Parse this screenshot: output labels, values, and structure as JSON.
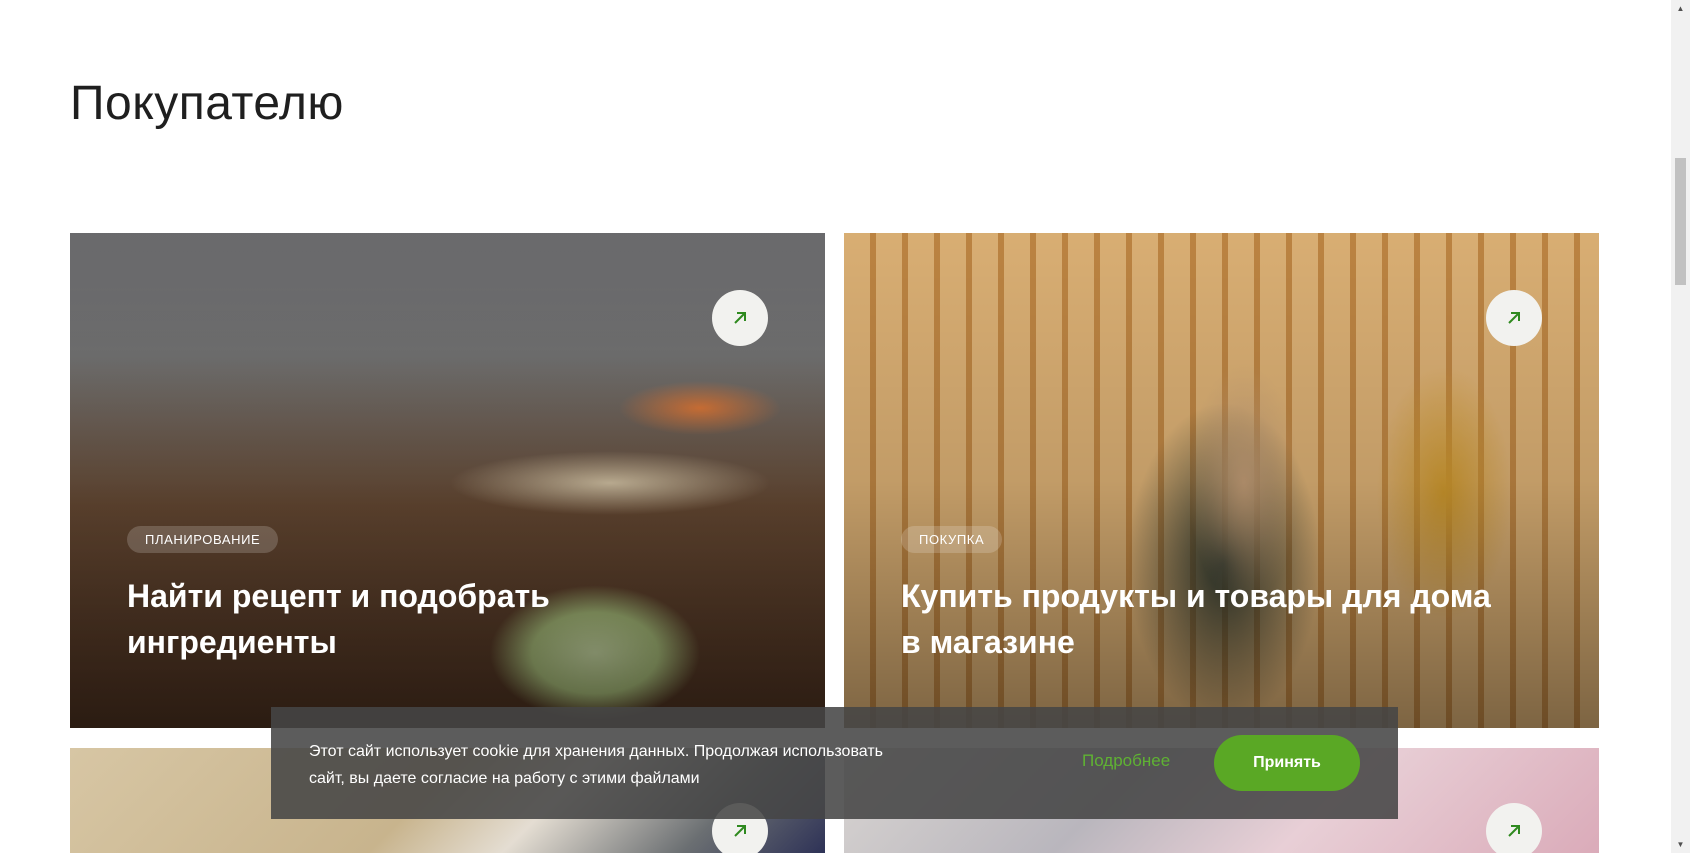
{
  "section": {
    "title": "Покупателю"
  },
  "cards": [
    {
      "tag": "ПЛАНИРОВАНИЕ",
      "title": "Найти рецепт и подобрать ингредиенты",
      "arrow_icon": "arrow-up-right-icon"
    },
    {
      "tag": "ПОКУПКА",
      "title": "Купить продукты и товары для дома в магазине",
      "arrow_icon": "arrow-up-right-icon"
    },
    {
      "arrow_icon": "arrow-up-right-icon"
    },
    {
      "arrow_icon": "arrow-up-right-icon"
    }
  ],
  "cookie": {
    "text": "Этот сайт использует cookie для хранения данных. Продолжая использовать сайт, вы даете согласие на работу с этими файлами",
    "more_label": "Подробнее",
    "accept_label": "Принять"
  },
  "colors": {
    "accent": "#5aa825",
    "link": "#5fb233",
    "arrow": "#2f8a1f"
  }
}
